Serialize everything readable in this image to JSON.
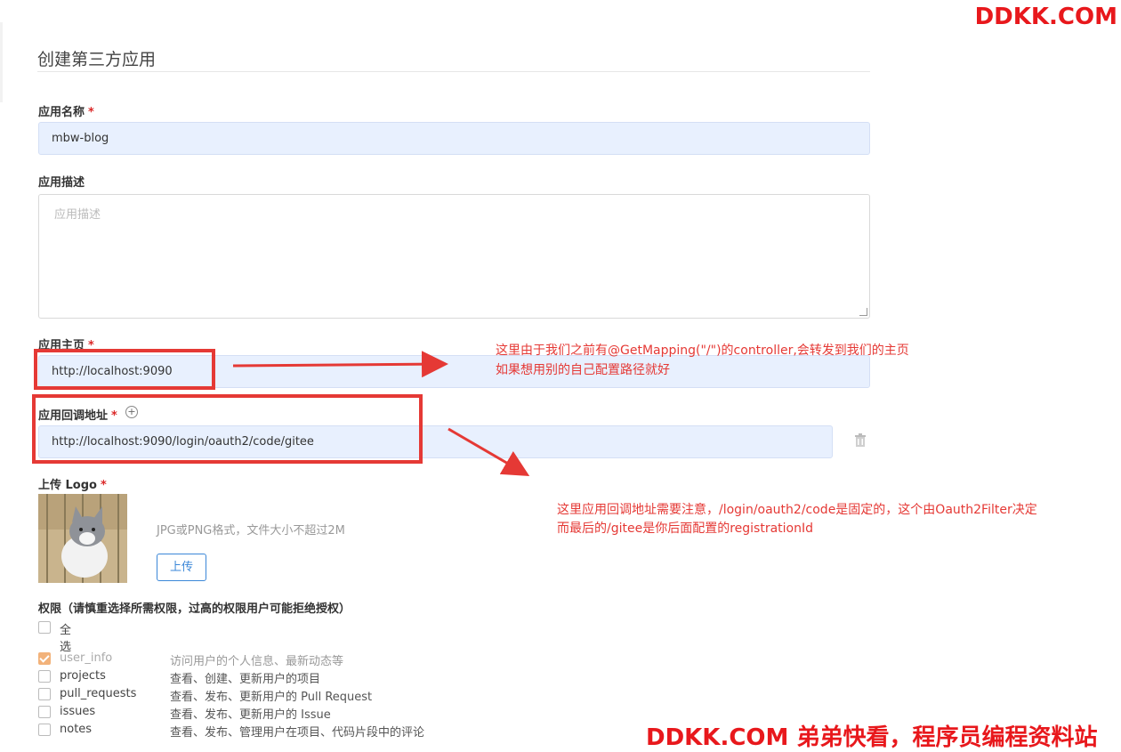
{
  "watermarks": {
    "top_right": "DDKK.COM",
    "bottom": "DDKK.COM 弟弟快看，程序员编程资料站"
  },
  "page": {
    "title": "创建第三方应用"
  },
  "form": {
    "app_name": {
      "label": "应用名称",
      "required": "*",
      "value": "mbw-blog"
    },
    "app_desc": {
      "label": "应用描述",
      "placeholder": "应用描述"
    },
    "homepage": {
      "label": "应用主页",
      "required": "*",
      "value": "http://localhost:9090"
    },
    "callback": {
      "label": "应用回调地址",
      "required": "*",
      "add_icon": "+",
      "value": "http://localhost:9090/login/oauth2/code/gitee"
    },
    "logo": {
      "label": "上传 Logo",
      "required": "*",
      "hint": "JPG或PNG格式，文件大小不超过2M",
      "upload_label": "上传"
    }
  },
  "permissions": {
    "title": "权限（请慎重选择所需权限，过高的权限用户可能拒绝授权）",
    "select_all": "全选",
    "scopes": [
      {
        "name": "user_info",
        "desc": "访问用户的个人信息、最新动态等",
        "checked": true
      },
      {
        "name": "projects",
        "desc": "查看、创建、更新用户的项目",
        "checked": false
      },
      {
        "name": "pull_requests",
        "desc": "查看、发布、更新用户的 Pull Request",
        "checked": false
      },
      {
        "name": "issues",
        "desc": "查看、发布、更新用户的 Issue",
        "checked": false
      },
      {
        "name": "notes",
        "desc": "查看、发布、管理用户在项目、代码片段中的评论",
        "checked": false
      }
    ]
  },
  "annotations": {
    "homepage_note_line1": "这里由于我们之前有@GetMapping(\"/\")的controller,会转发到我们的主页",
    "homepage_note_line2": "如果想用别的自己配置路径就好",
    "callback_note_line1": "这里应用回调地址需要注意，/login/oauth2/code是固定的，这个由Oauth2Filter决定",
    "callback_note_line2": "而最后的/gitee是你后面配置的registrationId"
  },
  "colors": {
    "annotation_red": "#e53935",
    "field_bg": "#e8f0fe",
    "checkbox_checked": "#f2b27a",
    "link_blue": "#3b87d8"
  },
  "icons": {
    "add": "plus-circle-icon",
    "delete": "trash-icon"
  }
}
